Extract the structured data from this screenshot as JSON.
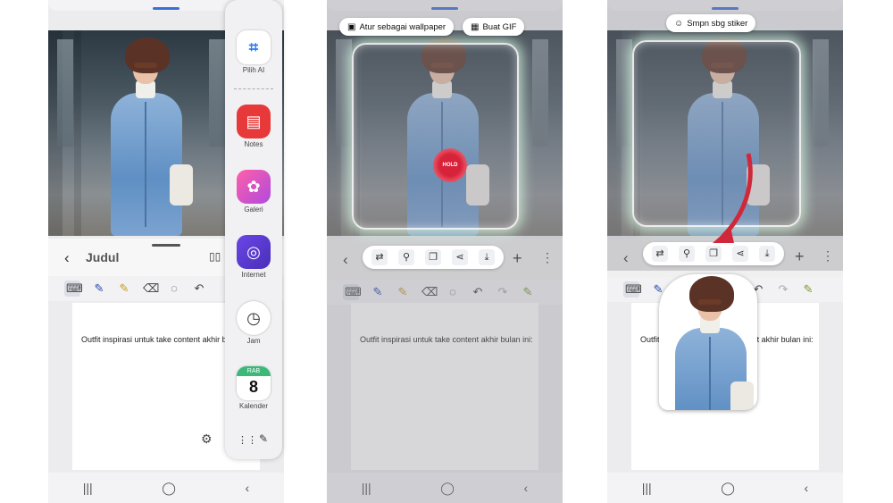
{
  "colors": {
    "accent": "#3b6fd8",
    "hold": "#d6233a",
    "coat": "#6f98c9"
  },
  "panel1": {
    "note_title": "Judul",
    "note_text": "Outfit inspirasi untuk take content akhir bulan ini:",
    "apps": [
      {
        "label": "Pilih AI",
        "icon": "select-ai-icon"
      },
      {
        "label": "Notes",
        "icon": "notes-icon"
      },
      {
        "label": "Galeri",
        "icon": "gallery-icon"
      },
      {
        "label": "Internet",
        "icon": "internet-icon"
      },
      {
        "label": "Jam",
        "icon": "clock-icon"
      },
      {
        "label": "Kalender",
        "icon": "calendar-icon",
        "badge": "RAB",
        "day": "8"
      }
    ]
  },
  "panel2": {
    "wallpaper_label": "Atur sebagai wallpaper",
    "gif_label": "Buat GIF",
    "hold_label": "HOLD",
    "note_text": "Outfit inspirasi untuk take content akhir bulan ini:"
  },
  "panel3": {
    "sticker_label": "Smpn sbg stiker",
    "note_text": "Outfit inspirasi untuk take content akhir bulan ini:"
  }
}
